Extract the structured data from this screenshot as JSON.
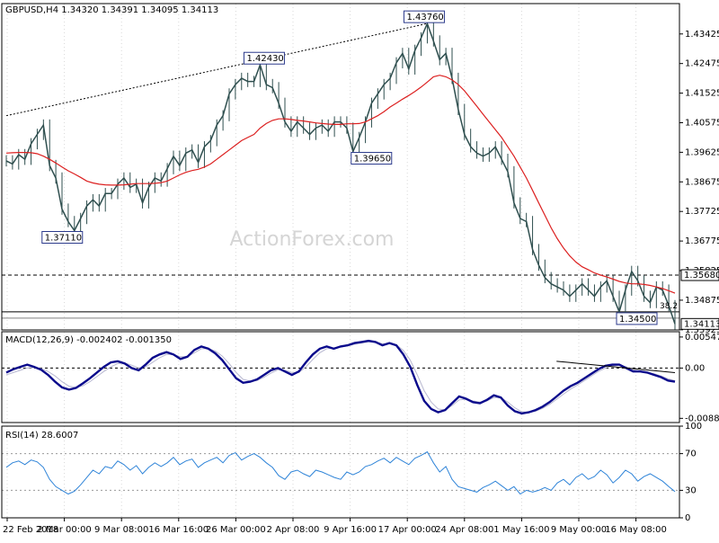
{
  "chart_data": {
    "type": "line",
    "symbol_info": {
      "text": "GBPUSD,H4  1.34320 1.34391 1.34095 1.34113",
      "symbol": "GBPUSD",
      "timeframe": "H4",
      "open": 1.3432,
      "high": 1.34391,
      "low": 1.34095,
      "close": 1.34113
    },
    "watermark": "ActionForex.com",
    "x_tick_labels": [
      "22 Feb 2018",
      "2 Mar 00:00",
      "9 Mar 08:00",
      "16 Mar 16:00",
      "26 Mar 00:00",
      "2 Apr 08:00",
      "9 Apr 16:00",
      "17 Apr 00:00",
      "24 Apr 08:00",
      "1 May 16:00",
      "9 May 00:00",
      "16 May 08:00"
    ],
    "price_panel": {
      "ylim": [
        1.3392,
        1.444
      ],
      "y_tick_labels": [
        "1.43425",
        "1.42475",
        "1.41525",
        "1.40575",
        "1.39625",
        "1.38675",
        "1.37725",
        "1.36775",
        "1.35825",
        "1.34875",
        "1.33925"
      ],
      "y_ticks": [
        1.43425,
        1.42475,
        1.41525,
        1.40575,
        1.39625,
        1.38675,
        1.37725,
        1.36775,
        1.35825,
        1.34875,
        1.33925
      ],
      "series": [
        {
          "key": "price",
          "color": "#2f4f4f",
          "values": [
            1.3935,
            1.3925,
            1.3955,
            1.394,
            1.399,
            1.402,
            1.405,
            1.392,
            1.388,
            1.378,
            1.374,
            1.3711,
            1.375,
            1.379,
            1.381,
            1.379,
            1.383,
            1.383,
            1.386,
            1.388,
            1.385,
            1.386,
            1.38,
            1.385,
            1.388,
            1.387,
            1.391,
            1.395,
            1.392,
            1.396,
            1.397,
            1.393,
            1.398,
            1.4,
            1.405,
            1.408,
            1.415,
            1.418,
            1.42,
            1.419,
            1.419,
            1.4243,
            1.418,
            1.417,
            1.412,
            1.406,
            1.403,
            1.406,
            1.404,
            1.402,
            1.404,
            1.405,
            1.403,
            1.406,
            1.406,
            1.404,
            1.3965,
            1.401,
            1.406,
            1.412,
            1.415,
            1.418,
            1.42,
            1.425,
            1.428,
            1.423,
            1.429,
            1.433,
            1.4376,
            1.432,
            1.426,
            1.428,
            1.42,
            1.41,
            1.402,
            1.398,
            1.396,
            1.395,
            1.396,
            1.398,
            1.394,
            1.39,
            1.38,
            1.375,
            1.374,
            1.365,
            1.36,
            1.356,
            1.354,
            1.353,
            1.352,
            1.35,
            1.352,
            1.354,
            1.352,
            1.35,
            1.353,
            1.355,
            1.35,
            1.345,
            1.352,
            1.358,
            1.355,
            1.35,
            1.348,
            1.353,
            1.352,
            1.347,
            1.3411
          ]
        },
        {
          "key": "ma",
          "color": "#dc2020",
          "values": [
            1.396,
            1.3961,
            1.3962,
            1.3962,
            1.3961,
            1.3958,
            1.395,
            1.394,
            1.3928,
            1.3915,
            1.3903,
            1.3893,
            1.3882,
            1.387,
            1.3864,
            1.386,
            1.3858,
            1.3857,
            1.3857,
            1.3858,
            1.386,
            1.3862,
            1.3862,
            1.3862,
            1.3863,
            1.3865,
            1.387,
            1.388,
            1.389,
            1.3898,
            1.3904,
            1.3908,
            1.3915,
            1.3925,
            1.394,
            1.3955,
            1.397,
            1.3985,
            1.4,
            1.401,
            1.402,
            1.404,
            1.4055,
            1.4065,
            1.407,
            1.407,
            1.4068,
            1.4065,
            1.4063,
            1.406,
            1.4057,
            1.4055,
            1.4053,
            1.4052,
            1.4052,
            1.4054,
            1.4054,
            1.4055,
            1.406,
            1.407,
            1.408,
            1.4093,
            1.4108,
            1.412,
            1.4133,
            1.4145,
            1.4158,
            1.4172,
            1.4188,
            1.4205,
            1.421,
            1.4205,
            1.4195,
            1.418,
            1.416,
            1.4135,
            1.411,
            1.4085,
            1.406,
            1.4035,
            1.401,
            1.398,
            1.395,
            1.3915,
            1.388,
            1.384,
            1.38,
            1.376,
            1.372,
            1.3685,
            1.3655,
            1.363,
            1.361,
            1.3595,
            1.3585,
            1.3575,
            1.3568,
            1.3562,
            1.3555,
            1.3548,
            1.3543,
            1.354,
            1.354,
            1.3538,
            1.3535,
            1.353,
            1.3525,
            1.3518,
            1.351
          ]
        }
      ],
      "trendline": {
        "from": [
          0,
          1.408
        ],
        "to": [
          68,
          1.4376
        ],
        "color": "#000000",
        "style": "dotted"
      },
      "hlines": [
        {
          "value": 1.3568,
          "style": "dashed",
          "color": "#000000"
        },
        {
          "value": 1.345,
          "style": "solid",
          "color": "#000000"
        },
        {
          "value": 1.343,
          "style": "solid",
          "color": "#808080"
        }
      ],
      "annotations": [
        {
          "text": "1.43760",
          "i": 68,
          "value": 1.4376,
          "anchor": "top",
          "dx": -26
        },
        {
          "text": "1.42430",
          "i": 41,
          "value": 1.4243,
          "anchor": "top",
          "dx": -18
        },
        {
          "text": "1.39650",
          "i": 56,
          "value": 1.3965,
          "anchor": "bottom",
          "dx": -2
        },
        {
          "text": "1.37110",
          "i": 11,
          "value": 1.3711,
          "anchor": "bottom",
          "dx": -36
        },
        {
          "text": "1.34500",
          "i": 99,
          "value": 1.345,
          "anchor": "bottom",
          "dx": -3
        }
      ],
      "fib_label": "38.2",
      "fib_value": 1.3455,
      "price_tags": [
        {
          "text": "1.35680",
          "value": 1.3568,
          "color": "#000000"
        },
        {
          "text": "1.34113",
          "value": 1.34113,
          "color": "#000000"
        }
      ]
    },
    "macd_panel": {
      "title": "MACD(12,26,9) -0.002402 -0.001350",
      "ylim": [
        -0.0096,
        0.0064
      ],
      "y_tick_labels": [
        "0.00547",
        "0.00",
        "-0.00886"
      ],
      "y_ticks": [
        0.00547,
        0.0,
        -0.00886
      ],
      "zero_line": 0.0,
      "series": [
        {
          "key": "macd",
          "color": "#0a0a8c",
          "values": [
            -0.0008,
            -0.0002,
            0.0002,
            0.0006,
            0.0002,
            -0.0003,
            -0.0012,
            -0.0024,
            -0.0034,
            -0.0038,
            -0.0035,
            -0.0027,
            -0.0018,
            -0.0008,
            0.0002,
            0.001,
            0.0012,
            0.0008,
            0.0,
            -0.0004,
            0.0006,
            0.0018,
            0.0024,
            0.0028,
            0.0024,
            0.0016,
            0.002,
            0.0032,
            0.0038,
            0.0034,
            0.0026,
            0.0014,
            -0.0002,
            -0.0018,
            -0.0026,
            -0.0024,
            -0.002,
            -0.0012,
            -0.0004,
            0.0,
            -0.0006,
            -0.0012,
            -0.0006,
            0.001,
            0.0024,
            0.0034,
            0.0038,
            0.0034,
            0.0038,
            0.004,
            0.0044,
            0.0046,
            0.0048,
            0.0046,
            0.004,
            0.0044,
            0.004,
            0.0024,
            0.0002,
            -0.003,
            -0.0058,
            -0.0072,
            -0.0078,
            -0.0074,
            -0.0062,
            -0.005,
            -0.0054,
            -0.006,
            -0.0062,
            -0.0056,
            -0.0048,
            -0.0052,
            -0.0066,
            -0.0076,
            -0.008,
            -0.0078,
            -0.0074,
            -0.0068,
            -0.006,
            -0.005,
            -0.004,
            -0.0032,
            -0.0026,
            -0.0018,
            -0.001,
            -0.0002,
            0.0004,
            0.0006,
            0.0006,
            0.0,
            -0.0006,
            -0.0006,
            -0.0008,
            -0.0012,
            -0.0016,
            -0.0022,
            -0.0024
          ]
        },
        {
          "key": "signal",
          "color": "#b9b9d1",
          "values": [
            -0.0012,
            -0.0008,
            -0.0004,
            0.0,
            0.0001,
            -0.0001,
            -0.0006,
            -0.0014,
            -0.0024,
            -0.0032,
            -0.0034,
            -0.0031,
            -0.0024,
            -0.0015,
            -0.0006,
            0.0002,
            0.0008,
            0.0009,
            0.0005,
            0.0,
            0.0002,
            0.001,
            0.0018,
            0.0024,
            0.0024,
            0.002,
            0.002,
            0.0027,
            0.0034,
            0.0034,
            0.003,
            0.0021,
            0.0008,
            -0.0008,
            -0.002,
            -0.0023,
            -0.0022,
            -0.0016,
            -0.0009,
            -0.0003,
            -0.0004,
            -0.0008,
            -0.0008,
            0.0002,
            0.0015,
            0.0027,
            0.0034,
            0.0035,
            0.0037,
            0.0039,
            0.0042,
            0.0044,
            0.0046,
            0.0046,
            0.0043,
            0.0043,
            0.0041,
            0.0031,
            0.0014,
            -0.0012,
            -0.004,
            -0.006,
            -0.0072,
            -0.0074,
            -0.0066,
            -0.0056,
            -0.0055,
            -0.0058,
            -0.006,
            -0.0058,
            -0.0052,
            -0.0052,
            -0.006,
            -0.007,
            -0.0077,
            -0.0078,
            -0.0076,
            -0.0071,
            -0.0064,
            -0.0055,
            -0.0046,
            -0.0037,
            -0.003,
            -0.0022,
            -0.0014,
            -0.0006,
            0.0,
            0.0004,
            0.0005,
            0.0002,
            -0.0003,
            -0.0005,
            -0.0007,
            -0.001,
            -0.0014,
            -0.0019,
            -0.0022
          ]
        }
      ],
      "trendline": {
        "from": [
          79,
          0.0012
        ],
        "to": [
          96,
          -0.0008
        ],
        "color": "#000000"
      }
    },
    "rsi_panel": {
      "title": "RSI(14) 28.6007",
      "ylim": [
        0,
        100
      ],
      "y_tick_labels": [
        "100",
        "70",
        "30",
        "0"
      ],
      "y_ticks": [
        100,
        70,
        30,
        0
      ],
      "levels": [
        70,
        30
      ],
      "series": [
        {
          "key": "rsi",
          "color": "#2f84d8",
          "values": [
            55,
            60,
            62,
            58,
            63,
            61,
            55,
            42,
            34,
            30,
            26,
            29,
            36,
            44,
            52,
            48,
            56,
            54,
            62,
            58,
            52,
            57,
            48,
            55,
            60,
            56,
            60,
            66,
            58,
            62,
            64,
            55,
            60,
            63,
            66,
            60,
            68,
            71,
            63,
            67,
            70,
            66,
            60,
            55,
            46,
            42,
            50,
            52,
            48,
            45,
            52,
            50,
            47,
            44,
            42,
            50,
            47,
            50,
            56,
            58,
            62,
            65,
            60,
            66,
            62,
            58,
            65,
            68,
            72,
            60,
            50,
            56,
            42,
            34,
            32,
            30,
            28,
            33,
            36,
            40,
            35,
            30,
            34,
            26,
            30,
            28,
            30,
            33,
            30,
            38,
            42,
            36,
            44,
            48,
            42,
            45,
            52,
            47,
            38,
            44,
            52,
            48,
            40,
            45,
            48,
            44,
            40,
            34,
            28.6
          ]
        }
      ]
    }
  }
}
